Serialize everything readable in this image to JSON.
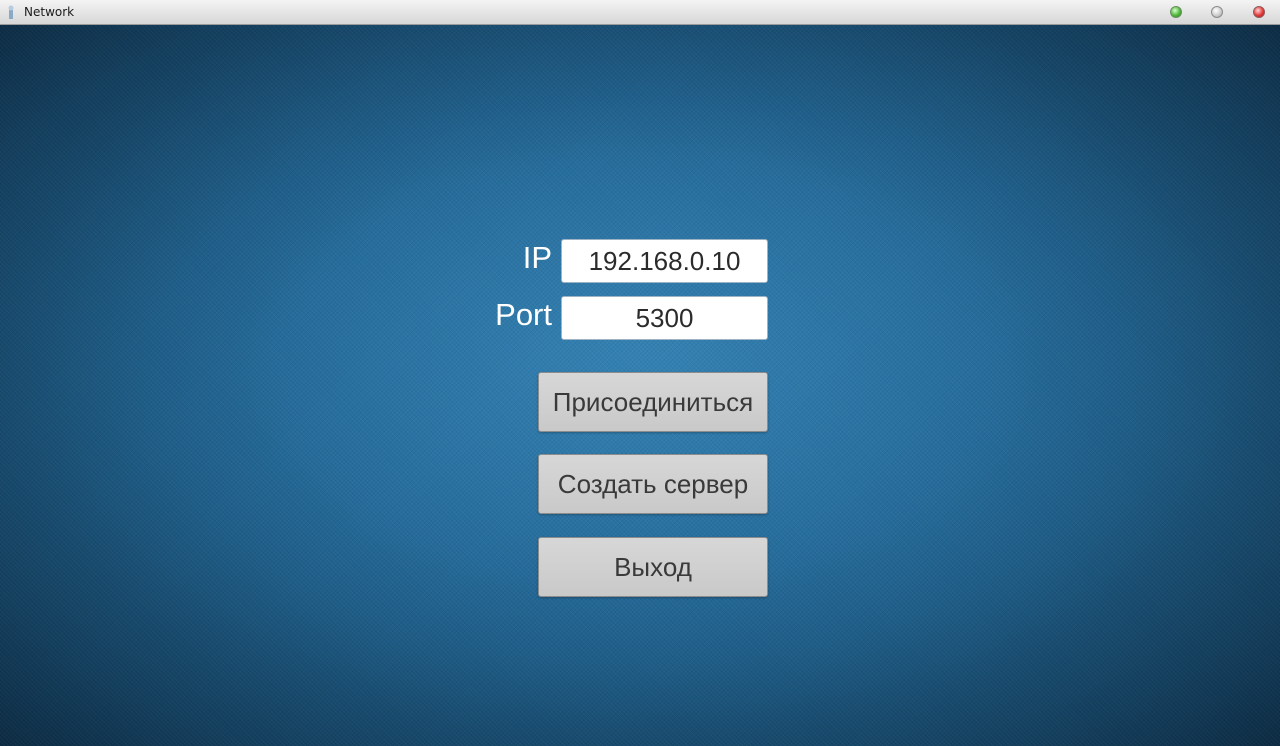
{
  "window": {
    "title": "Network",
    "controls": {
      "minimize_color": "#4fb83a",
      "maximize_color": "#cfcfcf",
      "close_color": "#e43a3a"
    }
  },
  "form": {
    "ip_label": "IP",
    "ip_value": "192.168.0.10",
    "port_label": "Port",
    "port_value": "5300"
  },
  "buttons": {
    "connect": "Присоединиться",
    "create_server": "Создать сервер",
    "exit": "Выход"
  },
  "colors": {
    "background": "#1f5f8c",
    "button_bg": "#d0d0d0",
    "field_bg": "#ffffff",
    "label_text": "#ffffff"
  }
}
